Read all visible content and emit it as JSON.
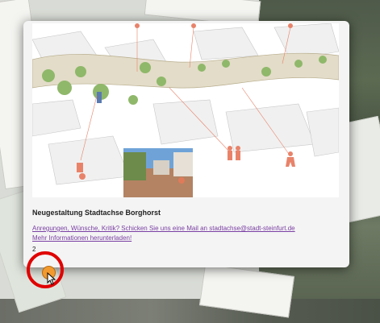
{
  "popup": {
    "title": "Neugestaltung Stadtachse Borghorst",
    "link_feedback": "Anregungen, Wünsche, Kritik? Schicken Sie uns eine Mail an stadtachse@stadt-steinfurt.de",
    "link_download": "Mehr Informationen herunterladen!",
    "count": "2"
  },
  "colors": {
    "link": "#7a3fa3",
    "marker": "#f29a2e",
    "highlight_ring": "#e00000",
    "plan_icon": "#e8836a"
  },
  "icons": [
    "map-marker-icon",
    "mouse-pointer-icon"
  ]
}
